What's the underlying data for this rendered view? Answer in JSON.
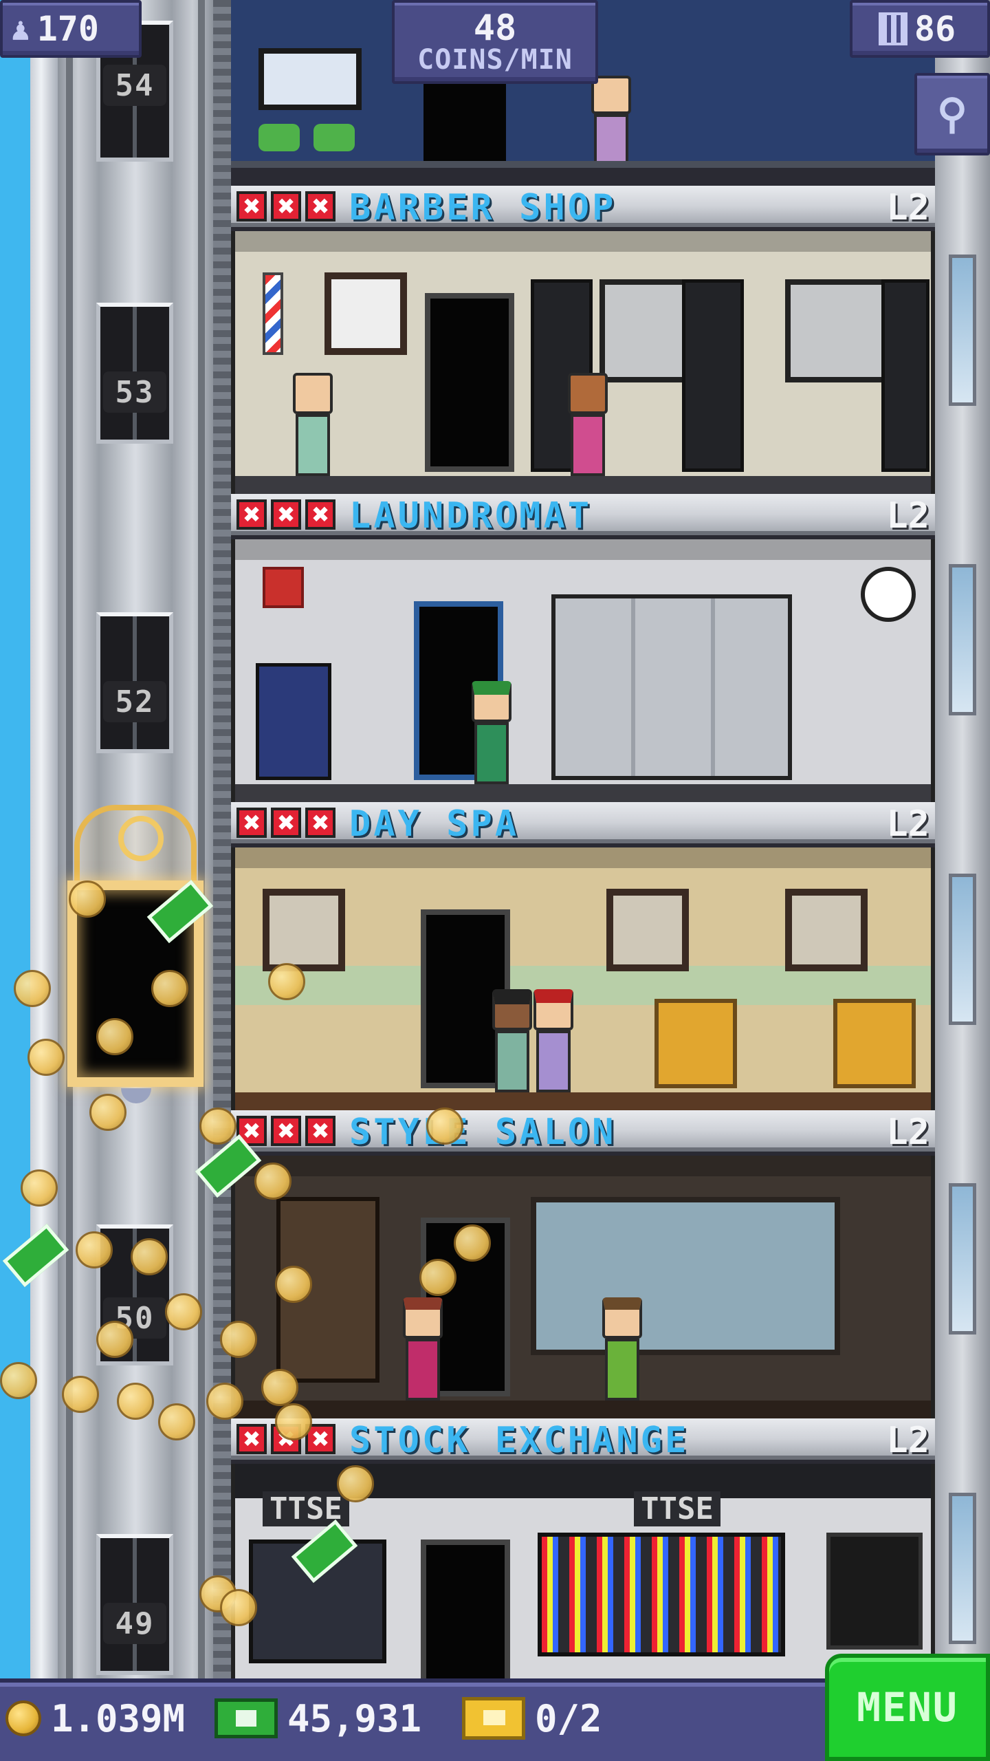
{
  "hud": {
    "population": "170",
    "income_rate_value": "48",
    "income_rate_unit": "COINS/MIN",
    "floors": "86",
    "zoom_icon": "magnifier-icon",
    "population_icon": "person-icon",
    "floors_icon": "building-icon"
  },
  "shaft": {
    "labels": [
      "54",
      "53",
      "52",
      "50",
      "49"
    ]
  },
  "floors": [
    {
      "name": "BARBER SHOP",
      "level": "L2",
      "stars_empty": 3,
      "bg": "#d8d4c4"
    },
    {
      "name": "LAUNDROMAT",
      "level": "L2",
      "stars_empty": 3,
      "bg": "#d5d6da"
    },
    {
      "name": "DAY SPA",
      "level": "L2",
      "stars_empty": 3,
      "bg": "#d8c69a"
    },
    {
      "name": "STYLE SALON",
      "level": "L2",
      "stars_empty": 3,
      "bg": "#3e3630"
    },
    {
      "name": "STOCK EXCHANGE",
      "level": "L2",
      "stars_empty": 3,
      "bg": "#2f3136"
    }
  ],
  "stock_exchange_sign": "TTSE",
  "stars": [
    "✖",
    "✖",
    "✖"
  ],
  "bottom_bar": {
    "coins": "1.039M",
    "bux": "45,931",
    "tickets": "0/2",
    "menu_label": "MENU"
  },
  "colors": {
    "hud_bg": "#4a4c86",
    "floor_name": "#3bb6f1",
    "menu_green": "#1fcf2f",
    "sky": "#3fb7ef"
  }
}
